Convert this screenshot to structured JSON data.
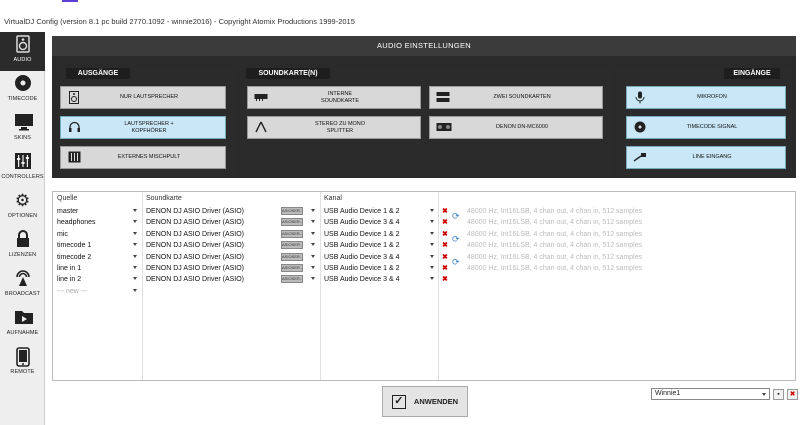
{
  "window": {
    "title": "VirtualDJ Config (version 8.1 pc build 2770.1092 - winnie2016) - Copyright Atomix Productions 1999-2015"
  },
  "sidebar": {
    "items": [
      {
        "label": "AUDIO",
        "icon": "speaker-icon",
        "active": true
      },
      {
        "label": "TIMECODE",
        "icon": "vinyl-icon"
      },
      {
        "label": "SKINS",
        "icon": "monitor-icon"
      },
      {
        "label": "CONTROLLERS",
        "icon": "sliders-icon"
      },
      {
        "label": "OPTIONEN",
        "icon": "gear-icon"
      },
      {
        "label": "LIZENZEN",
        "icon": "lock-icon"
      },
      {
        "label": "BROADCAST",
        "icon": "broadcast-icon"
      },
      {
        "label": "AUFNAHME",
        "icon": "folder-icon"
      },
      {
        "label": "REMOTE",
        "icon": "phone-icon"
      }
    ]
  },
  "header": {
    "title": "AUDIO EINSTELLUNGEN"
  },
  "panels": {
    "outputs": {
      "title": "AUSGÄNGE",
      "buttons": [
        {
          "label": "NUR LAUTSPRECHER",
          "icon": "speaker-icon"
        },
        {
          "label": "LAUTSPRECHER + KOPFHÖRER",
          "icon": "headphones-icon",
          "selected": true
        },
        {
          "label": "EXTERNES MISCHPULT",
          "icon": "mixer-icon"
        }
      ]
    },
    "soundcard": {
      "title": "SOUNDKARTE(N)",
      "buttons": [
        {
          "label": "INTERNE SOUNDKARTE",
          "icon": "soundcard-icon"
        },
        {
          "label": "ZWEI SOUNDKARTEN",
          "icon": "two-soundcards-icon"
        },
        {
          "label": "STEREO ZU MONO SPLITTER",
          "icon": "splitter-cable-icon"
        },
        {
          "label": "DENON DN-MC6000",
          "icon": "controller-device-icon"
        }
      ]
    },
    "inputs": {
      "title": "EINGÄNGE",
      "buttons": [
        {
          "label": "MIKROFON",
          "icon": "microphone-icon"
        },
        {
          "label": "TIMECODE SIGNAL",
          "icon": "vinyl-icon"
        },
        {
          "label": "LINE EINGANG",
          "icon": "cable-icon"
        }
      ]
    }
  },
  "grid": {
    "headers": {
      "source": "Quelle",
      "soundcard": "Soundkarte",
      "channel": "Kanal"
    },
    "asio_label": "ASIOSER...",
    "rows": [
      {
        "source": "master",
        "card": "DENON DJ ASIO Driver (ASIO)",
        "channel": "USB Audio Device 1 & 2",
        "info": "48000 Hz, Int16LSB, 4 chan out, 4 chan in, 512 samples"
      },
      {
        "source": "headphones",
        "card": "DENON DJ ASIO Driver (ASIO)",
        "channel": "USB Audio Device 3 & 4",
        "info": "48000 Hz, Int16LSB, 4 chan out, 4 chan in, 512 samples"
      },
      {
        "source": "mic",
        "card": "DENON DJ ASIO Driver (ASIO)",
        "channel": "USB Audio Device 1 & 2",
        "info": "48000 Hz, Int16LSB, 4 chan out, 4 chan in, 512 samples"
      },
      {
        "source": "timecode 1",
        "card": "DENON DJ ASIO Driver (ASIO)",
        "channel": "USB Audio Device 1 & 2",
        "info": "48000 Hz, Int16LSB, 4 chan out, 4 chan in, 512 samples"
      },
      {
        "source": "timecode 2",
        "card": "DENON DJ ASIO Driver (ASIO)",
        "channel": "USB Audio Device 3 & 4",
        "info": "48000 Hz, Int16LSB, 4 chan out, 4 chan in, 512 samples"
      },
      {
        "source": "line in 1",
        "card": "DENON DJ ASIO Driver (ASIO)",
        "channel": "USB Audio Device 1 & 2",
        "info": "48000 Hz, Int16LSB, 4 chan out, 4 chan in, 512 samples"
      },
      {
        "source": "line in 2",
        "card": "DENON DJ ASIO Driver (ASIO)",
        "channel": "USB Audio Device 3 & 4",
        "info": ""
      }
    ],
    "new_row": "--- new ---"
  },
  "footer": {
    "apply_label": "ANWENDEN",
    "preset_value": "Winnie1",
    "save_symbol": "💾",
    "delete_symbol": "✖"
  },
  "colors": {
    "accent_selected": "#c9e7f7",
    "dark_panel": "#2b2b2b",
    "delete_red": "#cc0000"
  }
}
